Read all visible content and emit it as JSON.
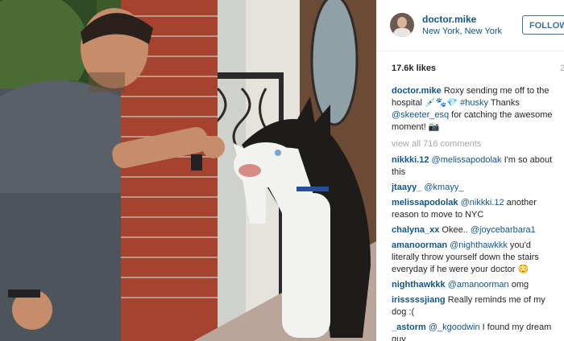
{
  "header": {
    "username": "doctor.mike",
    "location": "New York, New York",
    "follow_label": "FOLLOW"
  },
  "stats": {
    "likes": "17.6k likes",
    "time": "2"
  },
  "caption": {
    "user": "doctor.mike",
    "text_1": "Roxy sending me off to the hospital 💉🐾💎 ",
    "hashtag": "#husky",
    "text_2": " Thanks ",
    "mention": "@skeeter_esq",
    "text_3": " for catching the awesome moment! 📷"
  },
  "view_all": "view all 716 comments",
  "comments": [
    {
      "user": "nikkki.12",
      "mention": "@melissapodolak",
      "text": " I'm so about this"
    },
    {
      "user": "jtaayy_",
      "mention": "@kmayy_",
      "text": ""
    },
    {
      "user": "melissapodolak",
      "mention": "@nikkki.12",
      "text": " another reason to move to NYC"
    },
    {
      "user": "chalyna_xx",
      "mention": "",
      "text": "Okee.. ",
      "mention2": "@joycebarbara1"
    },
    {
      "user": "amanoorman",
      "mention": "@nighthawkkk",
      "text": " you'd literally throw yourself down the stairs everyday if he were your doctor 😳"
    },
    {
      "user": "nighthawkkk",
      "mention": "@amanoorman",
      "text": " omg"
    },
    {
      "user": "irisssssjiang",
      "mention": "",
      "text": "Really reminds me of my dog :("
    },
    {
      "user": "_astorm",
      "mention": "@_kgoodwin",
      "text": " I found my dream guy"
    }
  ],
  "colors": {
    "link": "#125688",
    "muted": "#a5a7aa",
    "follow": "#3f729b",
    "brick": "#a5432e"
  },
  "icons": [
    "follow-button",
    "avatar"
  ]
}
